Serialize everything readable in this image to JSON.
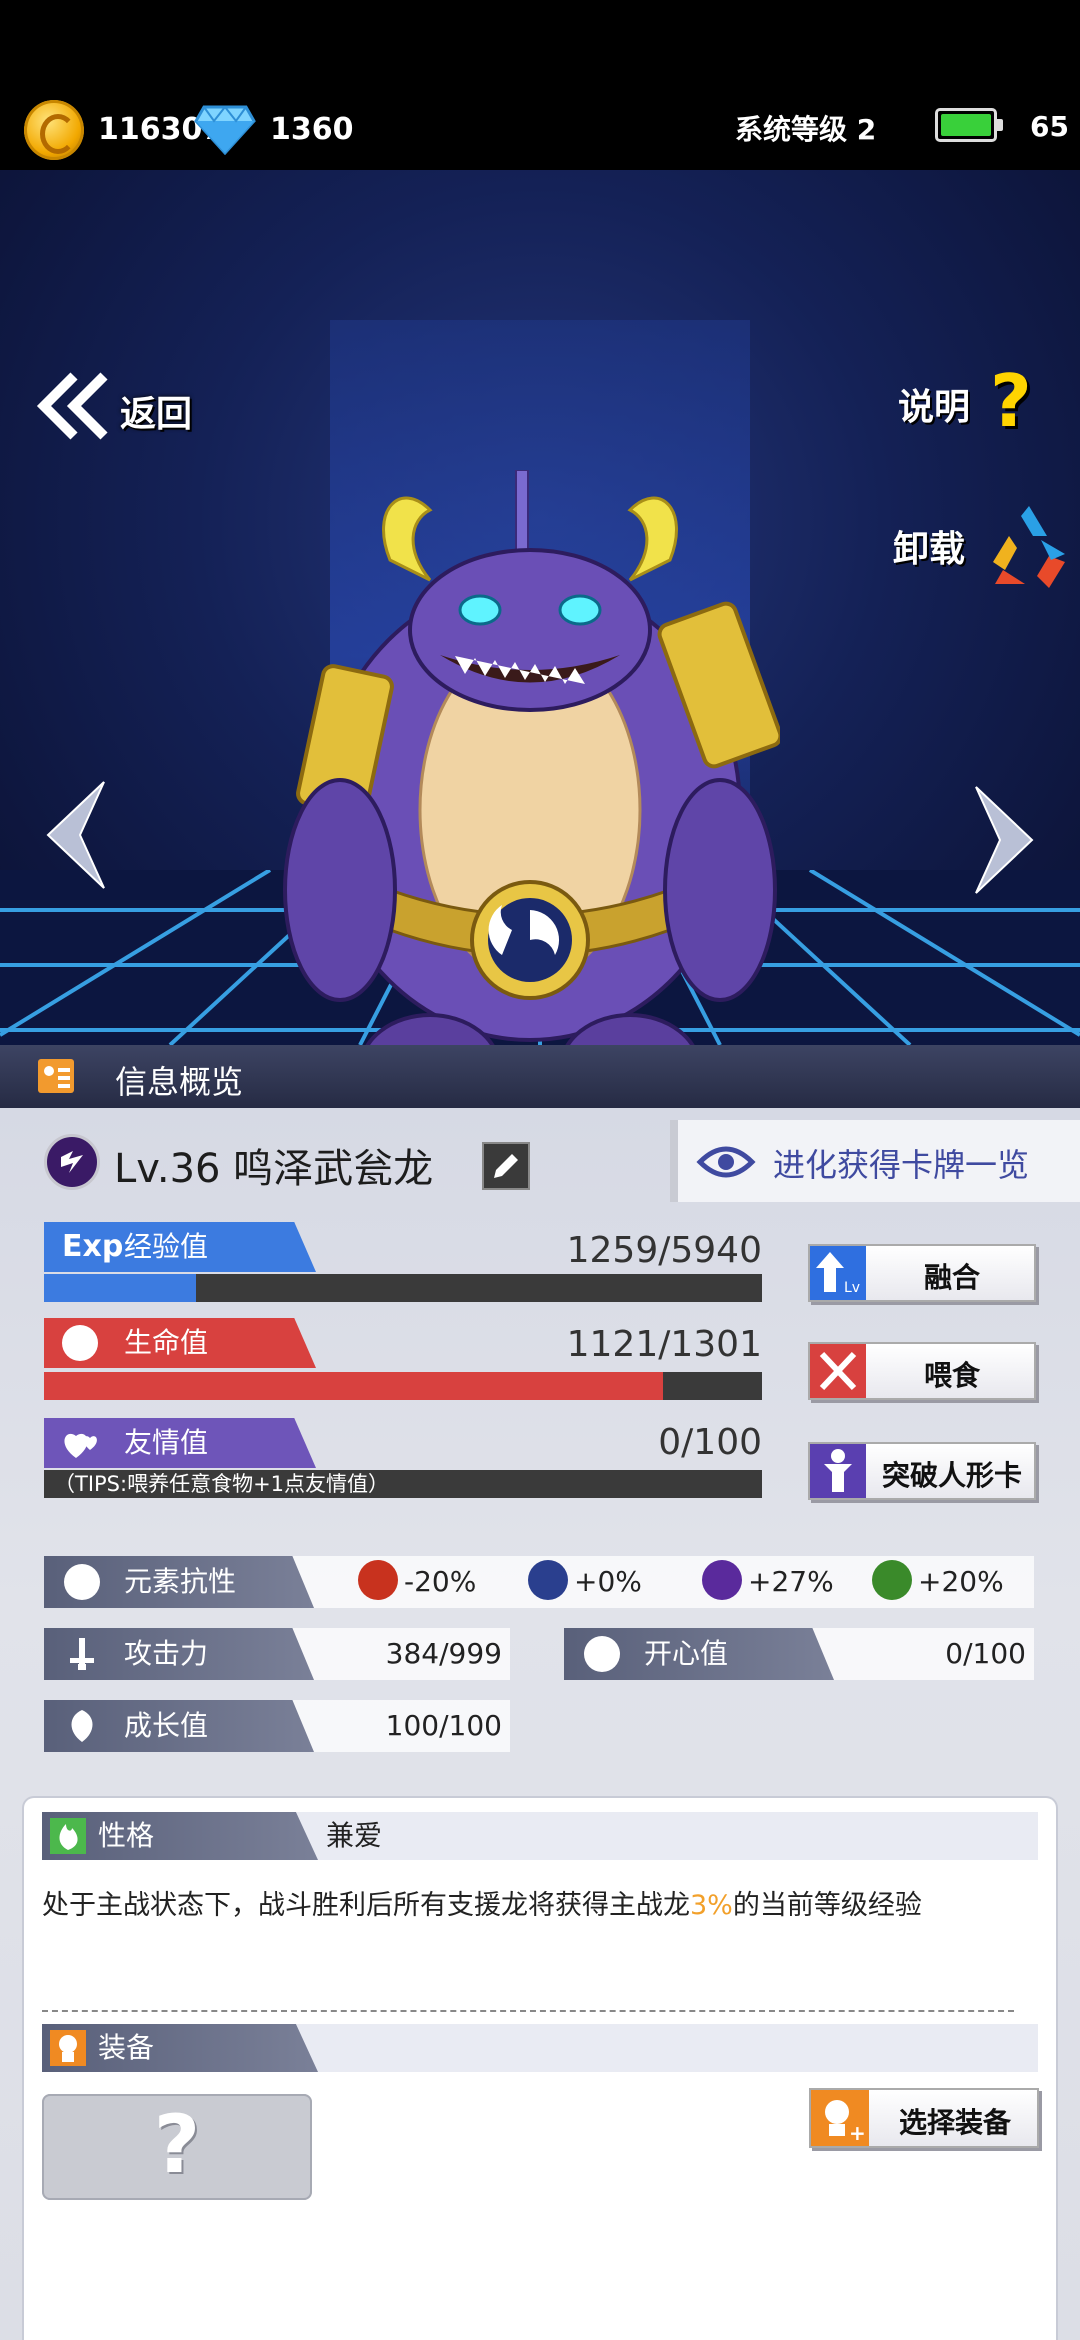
{
  "top_bar": {
    "gold": "116307",
    "diamonds": "1360",
    "system_level": "系统等级 2",
    "battery": "65"
  },
  "scene": {
    "back_label": "返回",
    "help_label": "说明",
    "unload_label": "卸载",
    "icons": [
      "back-chevron-icon",
      "question-mark-icon",
      "recycle-icon",
      "left-arrow-icon",
      "right-arrow-icon"
    ]
  },
  "info": {
    "title": "信息概览",
    "level_name": "Lv.36 鸣泽武瓮龙",
    "evolve_label": "进化获得卡牌一览",
    "exp": {
      "tag": "经验值",
      "tag_prefix": "Exp",
      "value": "1259/5940",
      "fraction": 0.212
    },
    "hp": {
      "tag": "生命值",
      "value": "1121/1301",
      "fraction": 0.862
    },
    "friendship": {
      "tag": "友情值",
      "value": "0/100",
      "tips": "（TIPS:喂养任意食物+1点友情值）"
    },
    "buttons": {
      "fuse": "融合",
      "feed": "喂食",
      "breakthrough": "突破人形卡"
    },
    "resistance": {
      "tag": "元素抗性",
      "values": [
        "-20%",
        "+0%",
        "+27%",
        "+20%"
      ],
      "colors": [
        "#c8321e",
        "#2a3f8e",
        "#5a2a9c",
        "#3a8a2a"
      ]
    },
    "attack": {
      "tag": "攻击力",
      "value": "384/999"
    },
    "happiness": {
      "tag": "开心值",
      "value": "0/100"
    },
    "growth": {
      "tag": "成长值",
      "value": "100/100"
    }
  },
  "card": {
    "trait_tag": "性格",
    "trait_value": "兼爱",
    "desc_before": "处于主战状态下，战斗胜利后所有支援龙将获得主战龙",
    "desc_highlight": "3%",
    "desc_after": "的当前等级经验",
    "equip_tag": "装备",
    "equip_placeholder": "?",
    "choose_label": "选择装备"
  },
  "colors": {
    "exp_blue": "#3c7be0",
    "hp_red": "#d8413f",
    "friend_purple": "#6e55b9",
    "highlight_orange": "#f2a02a"
  }
}
